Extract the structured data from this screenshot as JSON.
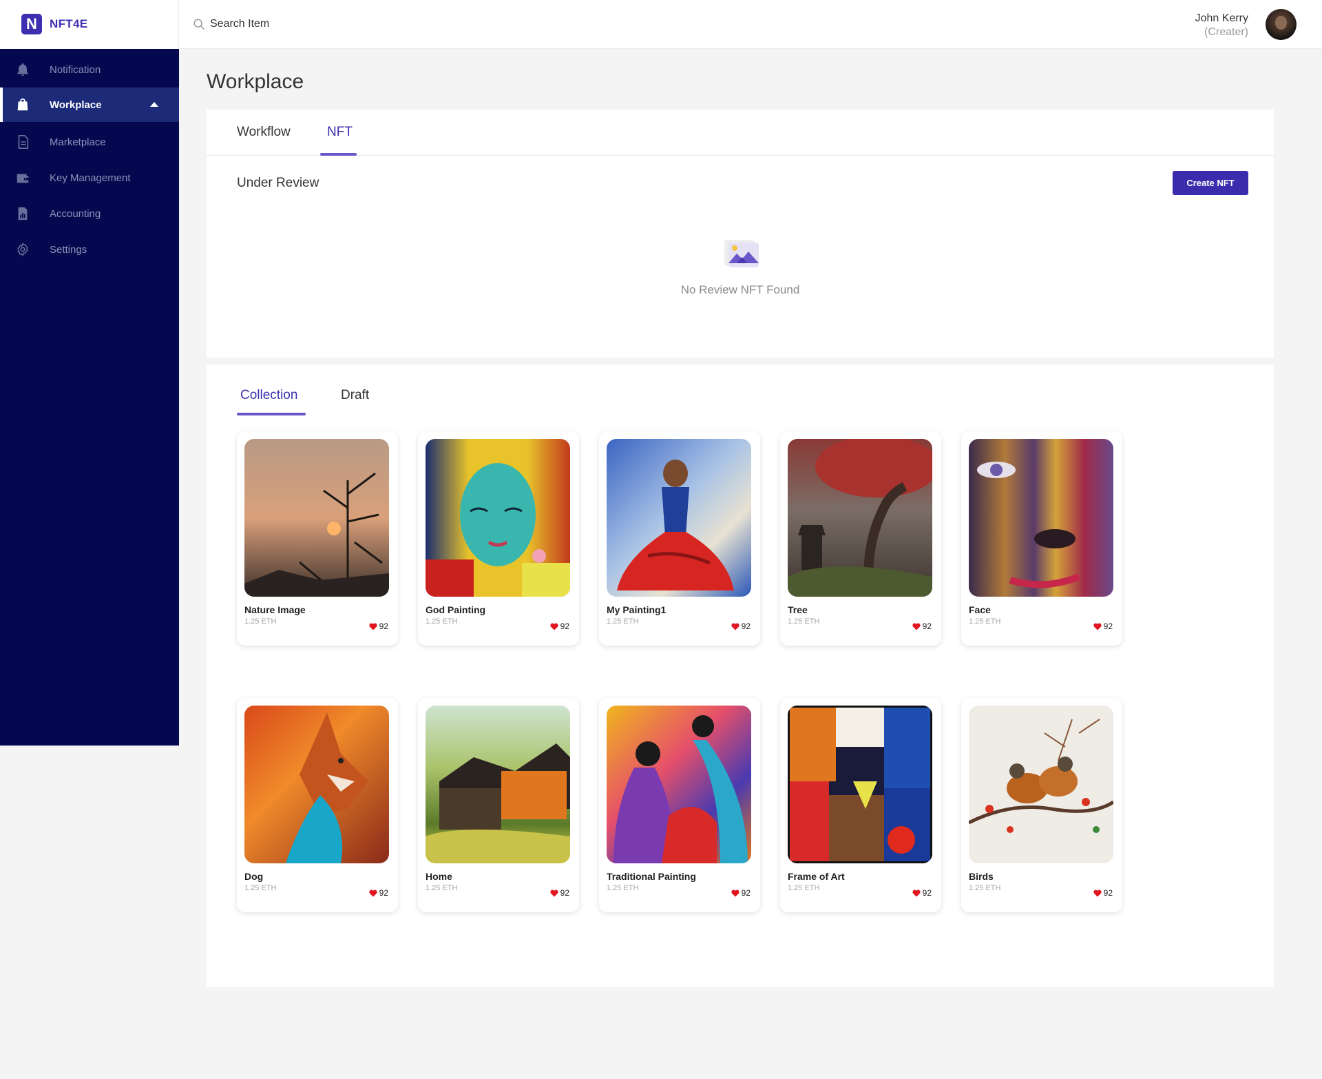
{
  "brand": {
    "logo_letter": "N",
    "name": "NFT4E"
  },
  "search": {
    "placeholder": "Search Item",
    "value": ""
  },
  "user": {
    "name": "John Kerry",
    "role": "(Creater)"
  },
  "sidebar": {
    "items": [
      {
        "label": "Notification",
        "icon": "bell-icon"
      },
      {
        "label": "Workplace",
        "icon": "shopping-bag-icon",
        "active": true
      },
      {
        "label": "Marketplace",
        "icon": "document-icon"
      },
      {
        "label": "Key Management",
        "icon": "wallet-icon"
      },
      {
        "label": "Accounting",
        "icon": "report-icon"
      },
      {
        "label": "Settings",
        "icon": "gear-icon"
      }
    ]
  },
  "page": {
    "title": "Workplace"
  },
  "top_tabs": [
    {
      "label": "Workflow"
    },
    {
      "label": "NFT",
      "active": true
    }
  ],
  "review": {
    "title": "Under Review",
    "create_button": "Create NFT",
    "empty_text": "No Review NFT Found"
  },
  "collection_tabs": [
    {
      "label": "Collection",
      "active": true
    },
    {
      "label": "Draft"
    }
  ],
  "nfts": [
    {
      "name": "Nature Image",
      "price": "1.25 ETH",
      "likes": "92"
    },
    {
      "name": "God Painting",
      "price": "1.25 ETH",
      "likes": "92"
    },
    {
      "name": "My Painting1",
      "price": "1.25 ETH",
      "likes": "92"
    },
    {
      "name": "Tree",
      "price": "1.25 ETH",
      "likes": "92"
    },
    {
      "name": "Face",
      "price": "1.25 ETH",
      "likes": "92"
    },
    {
      "name": "Dog",
      "price": "1.25 ETH",
      "likes": "92"
    },
    {
      "name": "Home",
      "price": "1.25 ETH",
      "likes": "92"
    },
    {
      "name": "Traditional Painting",
      "price": "1.25 ETH",
      "likes": "92"
    },
    {
      "name": "Frame of Art",
      "price": "1.25 ETH",
      "likes": "92"
    },
    {
      "name": "Birds",
      "price": "1.25 ETH",
      "likes": "92"
    }
  ],
  "colors": {
    "sidebar": "#06084f",
    "accent": "#3d2fb0",
    "heart": "#e0151f"
  }
}
